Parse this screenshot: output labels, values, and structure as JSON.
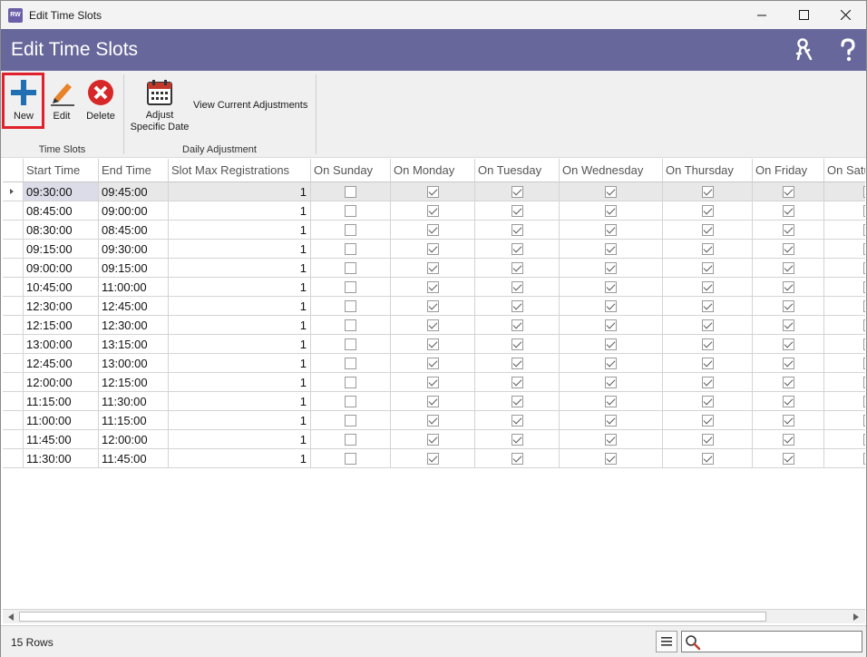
{
  "window": {
    "title": "Edit Time Slots",
    "icon_text": "RW"
  },
  "header": {
    "title": "Edit Time Slots"
  },
  "ribbon": {
    "new_label": "New",
    "edit_label": "Edit",
    "delete_label": "Delete",
    "adjust_label_1": "Adjust",
    "adjust_label_2": "Specific Date",
    "view_adjustments_label": "View Current Adjustments",
    "group_time_slots": "Time Slots",
    "group_daily_adjustment": "Daily Adjustment"
  },
  "grid": {
    "columns": [
      "Start Time",
      "End Time",
      "Slot Max Registrations",
      "On Sunday",
      "On Monday",
      "On Tuesday",
      "On Wednesday",
      "On Thursday",
      "On Friday",
      "On Saturday"
    ],
    "rows": [
      {
        "start": "09:30:00",
        "end": "09:45:00",
        "max": "1",
        "days": [
          false,
          true,
          true,
          true,
          true,
          true,
          false
        ]
      },
      {
        "start": "08:45:00",
        "end": "09:00:00",
        "max": "1",
        "days": [
          false,
          true,
          true,
          true,
          true,
          true,
          false
        ]
      },
      {
        "start": "08:30:00",
        "end": "08:45:00",
        "max": "1",
        "days": [
          false,
          true,
          true,
          true,
          true,
          true,
          false
        ]
      },
      {
        "start": "09:15:00",
        "end": "09:30:00",
        "max": "1",
        "days": [
          false,
          true,
          true,
          true,
          true,
          true,
          false
        ]
      },
      {
        "start": "09:00:00",
        "end": "09:15:00",
        "max": "1",
        "days": [
          false,
          true,
          true,
          true,
          true,
          true,
          false
        ]
      },
      {
        "start": "10:45:00",
        "end": "11:00:00",
        "max": "1",
        "days": [
          false,
          true,
          true,
          true,
          true,
          true,
          false
        ]
      },
      {
        "start": "12:30:00",
        "end": "12:45:00",
        "max": "1",
        "days": [
          false,
          true,
          true,
          true,
          true,
          true,
          false
        ]
      },
      {
        "start": "12:15:00",
        "end": "12:30:00",
        "max": "1",
        "days": [
          false,
          true,
          true,
          true,
          true,
          true,
          false
        ]
      },
      {
        "start": "13:00:00",
        "end": "13:15:00",
        "max": "1",
        "days": [
          false,
          true,
          true,
          true,
          true,
          true,
          false
        ]
      },
      {
        "start": "12:45:00",
        "end": "13:00:00",
        "max": "1",
        "days": [
          false,
          true,
          true,
          true,
          true,
          true,
          false
        ]
      },
      {
        "start": "12:00:00",
        "end": "12:15:00",
        "max": "1",
        "days": [
          false,
          true,
          true,
          true,
          true,
          true,
          false
        ]
      },
      {
        "start": "11:15:00",
        "end": "11:30:00",
        "max": "1",
        "days": [
          false,
          true,
          true,
          true,
          true,
          true,
          false
        ]
      },
      {
        "start": "11:00:00",
        "end": "11:15:00",
        "max": "1",
        "days": [
          false,
          true,
          true,
          true,
          true,
          true,
          false
        ]
      },
      {
        "start": "11:45:00",
        "end": "12:00:00",
        "max": "1",
        "days": [
          false,
          true,
          true,
          true,
          true,
          true,
          false
        ]
      },
      {
        "start": "11:30:00",
        "end": "11:45:00",
        "max": "1",
        "days": [
          false,
          true,
          true,
          true,
          true,
          true,
          false
        ]
      }
    ]
  },
  "status": {
    "row_count": "15 Rows",
    "search_value": ""
  },
  "colors": {
    "header_bg": "#67679b",
    "highlight": "#e0202a",
    "new_icon": "#1f6fb2",
    "delete_icon": "#d62828"
  }
}
